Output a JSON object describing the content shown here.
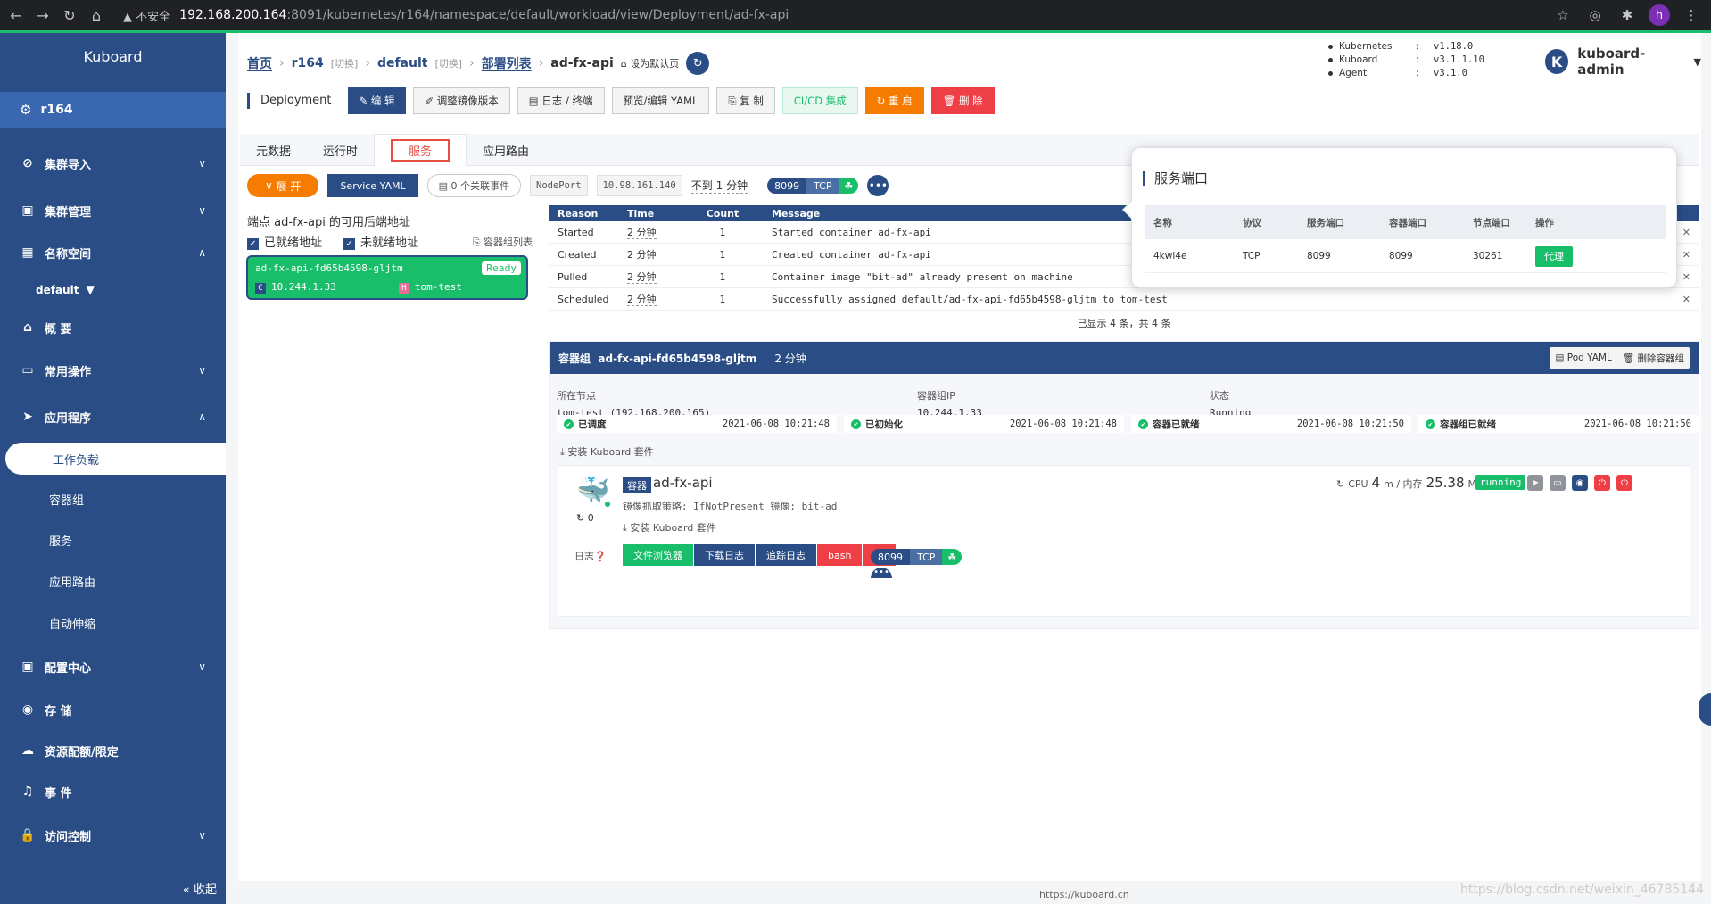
{
  "browser": {
    "warning": "不安全",
    "url_host": "192.168.200.164",
    "url_rest": ":8091/kubernetes/r164/namespace/default/workload/view/Deployment/ad-fx-api",
    "profile": "h"
  },
  "sidebar": {
    "brand": "Kuboard",
    "cluster": "r164",
    "items": {
      "import": "集群导入",
      "manage": "集群管理",
      "namespace": "名称空间",
      "ns_value": "default",
      "overview": "概 要",
      "common_ops": "常用操作",
      "apps": "应用程序",
      "workload": "工作负载",
      "pods": "容器组",
      "services": "服务",
      "ingress": "应用路由",
      "autoscale": "自动伸缩",
      "config": "配置中心",
      "storage": "存 储",
      "quota": "资源配额/限定",
      "events": "事 件",
      "access": "访问控制"
    },
    "collapse": "收起"
  },
  "breadcrumb": {
    "home": "首页",
    "cluster": "r164",
    "switch1": "[切换]",
    "ns": "default",
    "switch2": "[切换]",
    "deploy_list": "部署列表",
    "current": "ad-fx-api",
    "set_default": "设为默认页"
  },
  "versions": [
    {
      "name": "Kubernetes",
      "value": "v1.18.0"
    },
    {
      "name": "Kuboard",
      "value": "v3.1.1.10"
    },
    {
      "name": "Agent",
      "value": "v3.1.0"
    }
  ],
  "user": {
    "initial": "K",
    "name": "kuboard-admin"
  },
  "toolbar": {
    "type": "Deployment",
    "edit": "编 辑",
    "image_ver": "调整镜像版本",
    "logs": "日志 / 终端",
    "yaml": "预览/编辑 YAML",
    "copy": "复 制",
    "cicd": "CI/CD 集成",
    "restart": "重 启",
    "delete": "删 除"
  },
  "tabs": [
    "元数据",
    "运行时",
    "服务",
    "应用路由"
  ],
  "service": {
    "expand": "展 开",
    "yaml": "Service YAML",
    "events": "0 个关联事件",
    "type": "NodePort",
    "cluster_ip": "10.98.161.140",
    "age_prefix": "不到",
    "age_value": "1",
    "age_unit": "分钟",
    "port": "8099",
    "proto": "TCP"
  },
  "endpoints": {
    "title": "端点 ad-fx-api 的可用后端地址",
    "ready_label": "已就绪地址",
    "notready_label": "未就绪地址",
    "pod_list": "容器组列表",
    "pod_name": "ad-fx-api-fd65b4598-gljtm",
    "status": "Ready",
    "ip": "10.244.1.33",
    "node": "tom-test"
  },
  "events": {
    "headers": [
      "Reason",
      "Time",
      "Count",
      "Message"
    ],
    "rows": [
      {
        "reason": "Started",
        "time": "2 分钟",
        "count": "1",
        "msg": "Started container ad-fx-api"
      },
      {
        "reason": "Created",
        "time": "2 分钟",
        "count": "1",
        "msg": "Created container ad-fx-api"
      },
      {
        "reason": "Pulled",
        "time": "2 分钟",
        "count": "1",
        "msg": "Container image \"bit-ad\" already present on machine"
      },
      {
        "reason": "Scheduled",
        "time": "2 分钟",
        "count": "1",
        "msg": "Successfully assigned default/ad-fx-api-fd65b4598-gljtm to tom-test"
      }
    ],
    "footer": "已显示 4 条，共 4 条"
  },
  "pod": {
    "label": "容器组",
    "name": "ad-fx-api-fd65b4598-gljtm",
    "age": "2 分钟",
    "pod_yaml": "Pod YAML",
    "delete": "删除容器组",
    "node_label": "所在节点",
    "node_value": "tom-test (192.168.200.165)",
    "ip_label": "容器组IP",
    "ip_value": "10.244.1.33",
    "state_label": "状态",
    "state_value": "Running",
    "conditions": [
      {
        "name": "已调度",
        "time": "2021-06-08 10:21:48"
      },
      {
        "name": "已初始化",
        "time": "2021-06-08 10:21:48"
      },
      {
        "name": "容器已就绪",
        "time": "2021-06-08 10:21:50"
      },
      {
        "name": "容器组已就绪",
        "time": "2021-06-08 10:21:50"
      }
    ],
    "install": "安装 Kuboard 套件"
  },
  "container": {
    "tag": "容器",
    "name": "ad-fx-api",
    "restarts": "0",
    "meta": "镜像抓取策略: IfNotPresent   镜像: bit-ad",
    "install": "安装 Kuboard 套件",
    "cpu_label": "CPU",
    "cpu_value": "4",
    "cpu_unit": "m / 内存",
    "mem_value": "25.38",
    "mem_unit": "MiB",
    "status": "running",
    "logs_label": "日志",
    "log_buttons": [
      "文件浏览器",
      "下载日志",
      "追踪日志",
      "bash",
      "sh"
    ],
    "port": "8099",
    "proto": "TCP"
  },
  "popover": {
    "title": "服务端口",
    "headers": [
      "名称",
      "协议",
      "服务端口",
      "容器端口",
      "节点端口",
      "操作"
    ],
    "row": {
      "name": "4kwi4e",
      "proto": "TCP",
      "svc_port": "8099",
      "container_port": "8099",
      "node_port": "30261",
      "action": "代理"
    }
  },
  "footer": "https://kuboard.cn",
  "watermark": "https://blog.csdn.net/weixin_46785144",
  "colors": {
    "primary": "#2a4d85",
    "success": "#19be6b",
    "warning": "#f57c00",
    "danger": "#ed3f45"
  }
}
